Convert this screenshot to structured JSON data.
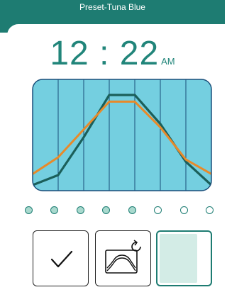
{
  "header": {
    "title": "Preset-Tuna Blue"
  },
  "clock": {
    "time": "12 : 22",
    "period": "AM"
  },
  "chart_data": {
    "type": "line",
    "x": [
      0,
      1,
      2,
      3,
      4,
      5,
      6,
      7
    ],
    "series": [
      {
        "values": [
          5,
          14,
          48,
          86,
          86,
          60,
          26,
          5
        ],
        "color": "#1b5f5a"
      },
      {
        "values": [
          15,
          30,
          55,
          80,
          80,
          57,
          28,
          15
        ],
        "color": "#e88a2a"
      }
    ],
    "ylim": [
      0,
      100
    ],
    "grid": true,
    "background": "#74cfe0",
    "grid_color": "#1a4f7a"
  },
  "pager": {
    "dots": [
      true,
      true,
      true,
      true,
      true,
      false,
      false,
      false
    ]
  },
  "actions": {
    "confirm_icon": "checkmark-icon",
    "curve_icon": "curve-reset-icon",
    "color_swatch_fill": 0.75,
    "swatch_color": "#d3ece6"
  },
  "colors": {
    "accent": "#1e7c72",
    "text_accent": "#21857a"
  }
}
